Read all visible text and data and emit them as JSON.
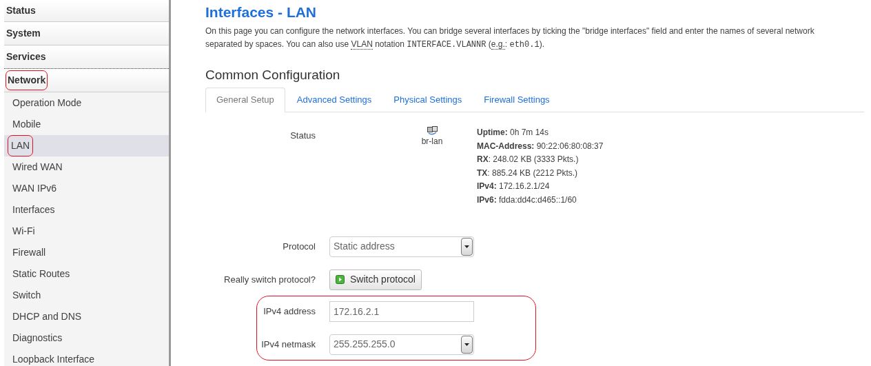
{
  "sidebar": {
    "sections": [
      {
        "label": "Status",
        "highlighted": false
      },
      {
        "label": "System",
        "highlighted": false
      },
      {
        "label": "Services",
        "highlighted": false
      },
      {
        "label": "Network",
        "highlighted": true,
        "items": [
          {
            "label": "Operation Mode",
            "selected": false,
            "highlighted": false
          },
          {
            "label": "Mobile",
            "selected": false,
            "highlighted": false
          },
          {
            "label": "LAN",
            "selected": true,
            "highlighted": true
          },
          {
            "label": "Wired WAN",
            "selected": false,
            "highlighted": false
          },
          {
            "label": "WAN IPv6",
            "selected": false,
            "highlighted": false
          },
          {
            "label": "Interfaces",
            "selected": false,
            "highlighted": false
          },
          {
            "label": "Wi-Fi",
            "selected": false,
            "highlighted": false
          },
          {
            "label": "Firewall",
            "selected": false,
            "highlighted": false
          },
          {
            "label": "Static Routes",
            "selected": false,
            "highlighted": false
          },
          {
            "label": "Switch",
            "selected": false,
            "highlighted": false
          },
          {
            "label": "DHCP and DNS",
            "selected": false,
            "highlighted": false
          },
          {
            "label": "Diagnostics",
            "selected": false,
            "highlighted": false
          },
          {
            "label": "Loopback Interface",
            "selected": false,
            "highlighted": false
          }
        ]
      }
    ]
  },
  "page": {
    "title": "Interfaces - LAN",
    "description": [
      [
        {
          "kind": "text",
          "text": "On this page you can configure the network interfaces. You can bridge several interfaces by ticking the \"bridge interfaces\" field and enter the names of several network"
        }
      ],
      [
        {
          "kind": "text",
          "text": "separated by spaces. You can also use "
        },
        {
          "kind": "abbr",
          "text": "VLAN"
        },
        {
          "kind": "text",
          "text": " notation "
        },
        {
          "kind": "code",
          "text": "INTERFACE.VLANNR"
        },
        {
          "kind": "text",
          "text": " ("
        },
        {
          "kind": "abbr",
          "text": "e.g."
        },
        {
          "kind": "text",
          "text": ": "
        },
        {
          "kind": "code",
          "text": "eth0.1"
        },
        {
          "kind": "text",
          "text": ")."
        }
      ]
    ]
  },
  "section": {
    "title": "Common Configuration",
    "tabs": [
      {
        "label": "General Setup",
        "selected": true
      },
      {
        "label": "Advanced Settings",
        "selected": false
      },
      {
        "label": "Physical Settings",
        "selected": false
      },
      {
        "label": "Firewall Settings",
        "selected": false
      }
    ]
  },
  "status": {
    "label": "Status",
    "device": "br-lan",
    "lines": [
      {
        "key": "Uptime:",
        "value": " 0h 7m 14s"
      },
      {
        "key": "MAC-Address:",
        "value": " 90:22:06:80:08:37"
      },
      {
        "key": "RX",
        "value": ": 248.02 KB (3333 Pkts.)"
      },
      {
        "key": "TX",
        "value": ": 885.24 KB (2212 Pkts.)"
      },
      {
        "key": "IPv4:",
        "value": " 172.16.2.1/24"
      },
      {
        "key": "IPv6:",
        "value": " fdda:dd4c:d465::1/60"
      }
    ]
  },
  "fields": [
    {
      "kind": "select",
      "label": "Protocol",
      "value": "Static address",
      "highlighted": false
    },
    {
      "kind": "button",
      "label": "Really switch protocol?",
      "value": "Switch protocol",
      "highlighted": false
    },
    {
      "kind": "input",
      "label": "IPv4 address",
      "value": "172.16.2.1",
      "highlighted": true
    },
    {
      "kind": "select",
      "label": "IPv4 netmask",
      "value": "255.255.255.0",
      "highlighted": true
    }
  ]
}
